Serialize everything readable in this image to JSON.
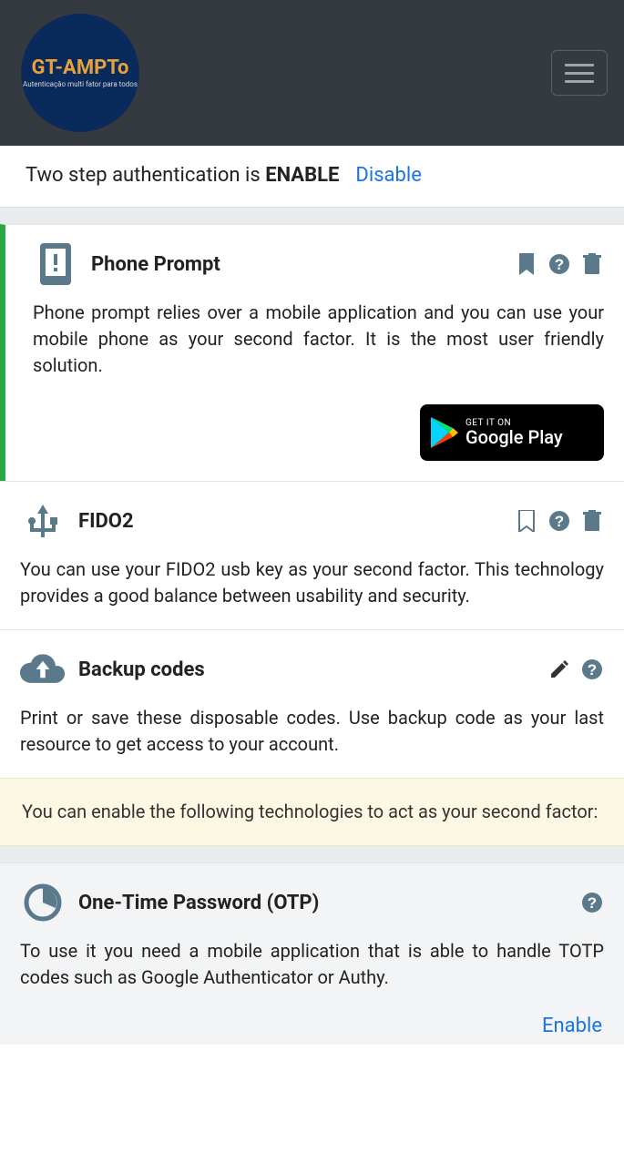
{
  "logo": {
    "title": "GT-AMPTo",
    "subtitle": "Autenticação multi fator\npara todos"
  },
  "status": {
    "prefix": "Two step authentication is ",
    "state": "ENABLE",
    "action": "Disable"
  },
  "methods": {
    "phone": {
      "title": "Phone Prompt",
      "desc": "Phone prompt relies over a mobile application and you can use your mobile phone as your second factor. It is the most user friendly solution.",
      "badge_small": "GET IT ON",
      "badge_big": "Google Play"
    },
    "fido2": {
      "title": "FIDO2",
      "desc": "You can use your FIDO2 usb key as your second factor. This technology provides a good balance between usability and security."
    },
    "backup": {
      "title": "Backup codes",
      "desc": "Print or save these disposable codes. Use backup code as your last resource to get access to your account."
    }
  },
  "notice": "You can enable the following technologies to act as your second factor:",
  "available": {
    "otp": {
      "title": "One-Time Password (OTP)",
      "desc": "To use it you need a mobile application that is able to handle TOTP codes such as Google Authenticator or Authy.",
      "action": "Enable"
    }
  }
}
